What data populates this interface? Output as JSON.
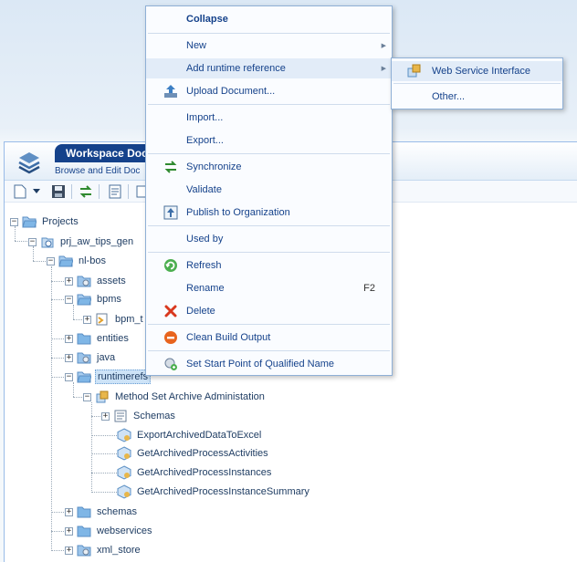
{
  "workspace": {
    "title": "Workspace Doc",
    "subtitle": "Browse and Edit Doc"
  },
  "tree": {
    "nodes": [
      {
        "label": "Projects",
        "expander": "−",
        "icon": "folder-open-icon"
      },
      {
        "label": "prj_aw_tips_gen",
        "expander": "−",
        "icon": "project-icon"
      },
      {
        "label": "nl-bos",
        "expander": "−",
        "icon": "folder-open-icon"
      },
      {
        "label": "assets",
        "expander": "+",
        "icon": "package-folder-icon"
      },
      {
        "label": "bpms",
        "expander": "−",
        "icon": "folder-open-icon"
      },
      {
        "label": "bpm_t",
        "expander": "+",
        "icon": "bpm-icon"
      },
      {
        "label": "entities",
        "expander": "+",
        "icon": "folder-icon"
      },
      {
        "label": "java",
        "expander": "+",
        "icon": "package-folder-icon"
      },
      {
        "label": "runtimerefs",
        "expander": "−",
        "icon": "folder-open-icon"
      },
      {
        "label": "Method Set Archive Administation",
        "expander": "−",
        "icon": "method-set-icon"
      },
      {
        "label": "Schemas",
        "expander": "+",
        "icon": "schemas-icon"
      },
      {
        "label": "ExportArchivedDataToExcel",
        "expander": "",
        "icon": "web-service-icon"
      },
      {
        "label": "GetArchivedProcessActivities",
        "expander": "",
        "icon": "web-service-icon"
      },
      {
        "label": "GetArchivedProcessInstances",
        "expander": "",
        "icon": "web-service-icon"
      },
      {
        "label": "GetArchivedProcessInstanceSummary",
        "expander": "",
        "icon": "web-service-icon"
      },
      {
        "label": "schemas",
        "expander": "+",
        "icon": "folder-icon"
      },
      {
        "label": "webservices",
        "expander": "+",
        "icon": "folder-icon"
      },
      {
        "label": "xml_store",
        "expander": "+",
        "icon": "package-folder-icon"
      }
    ]
  },
  "context_menu": {
    "collapse": "Collapse",
    "new": "New",
    "add_runtime_reference": "Add runtime reference",
    "upload_document": "Upload Document...",
    "import": "Import...",
    "export": "Export...",
    "synchronize": "Synchronize",
    "validate": "Validate",
    "publish": "Publish to Organization",
    "used_by": "Used by",
    "refresh": "Refresh",
    "rename": "Rename",
    "rename_shortcut": "F2",
    "delete": "Delete",
    "clean_build_output": "Clean Build Output",
    "set_start_point": "Set Start Point of Qualified Name"
  },
  "submenu": {
    "web_service_interface": "Web Service Interface",
    "other": "Other..."
  },
  "colors": {
    "accent": "#15428b",
    "folder": "#7fb6e6",
    "highlight": "#e2ecf8"
  }
}
